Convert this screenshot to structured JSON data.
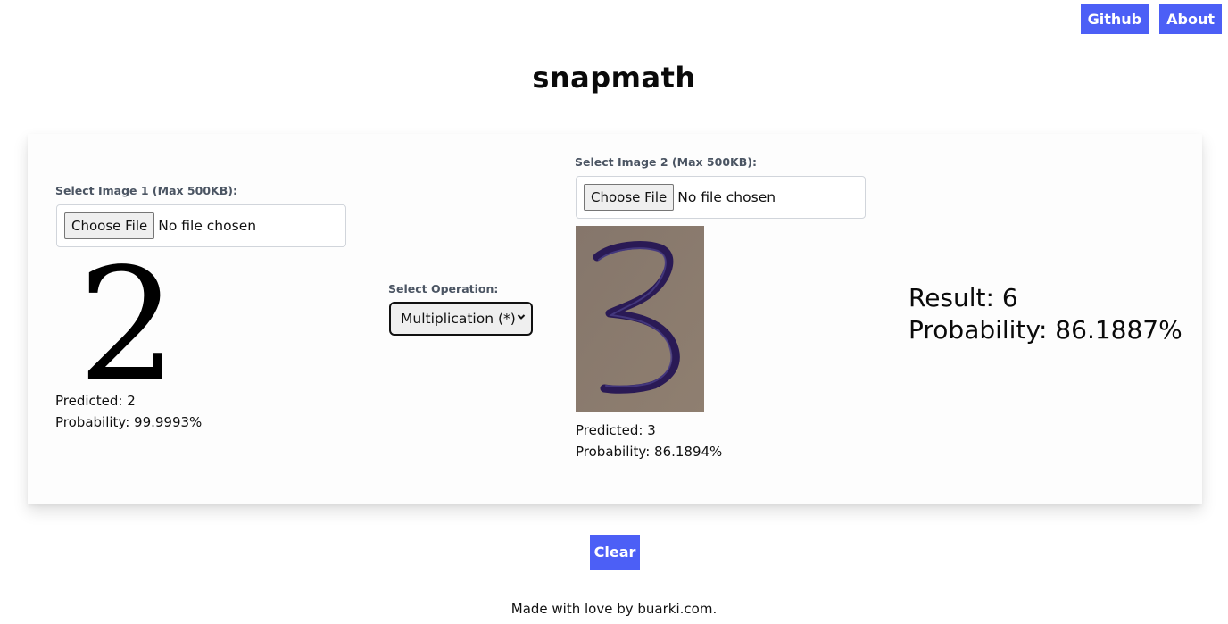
{
  "nav": {
    "github_label": "Github",
    "about_label": "About"
  },
  "header": {
    "title": "snapmath"
  },
  "colors": {
    "accent": "#4c5ff6"
  },
  "image1": {
    "label": "Select Image 1 (Max 500KB):",
    "choose_file_label": "Choose File",
    "file_status": "No file chosen",
    "preview_digit": "2",
    "predicted": "Predicted: 2",
    "probability": "Probability: 99.9993%"
  },
  "operation": {
    "label": "Select Operation:",
    "selected": "Multiplication (*)"
  },
  "image2": {
    "label": "Select Image 2 (Max 500KB):",
    "choose_file_label": "Choose File",
    "file_status": "No file chosen",
    "preview_alt": "handwritten digit 3",
    "predicted": "Predicted: 3",
    "probability": "Probability: 86.1894%"
  },
  "result": {
    "value": "Result: 6",
    "probability": "Probability: 86.1887%"
  },
  "actions": {
    "clear_label": "Clear"
  },
  "footer": {
    "text_prefix": "Made with love by ",
    "link_text": "buarki.com",
    "text_suffix": "."
  }
}
